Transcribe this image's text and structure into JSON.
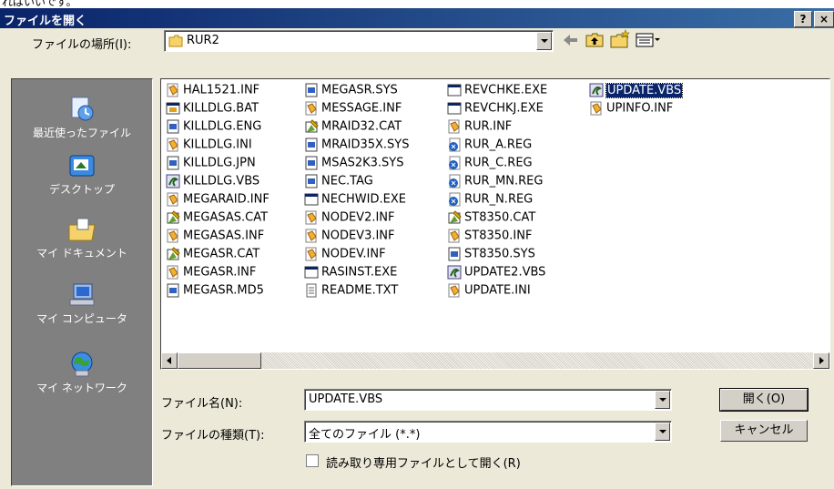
{
  "top_strip_text": "ればいいです。",
  "window": {
    "title": "ファイルを開く",
    "help_button": "?",
    "close_button": "×"
  },
  "look_in": {
    "label": "ファイルの場所(I):",
    "value": "RUR2"
  },
  "toolbar": {
    "back_icon": "back-arrow-icon",
    "up_icon": "up-folder-icon",
    "new_folder_icon": "new-folder-icon",
    "view_icon": "view-menu-icon"
  },
  "places": [
    {
      "label": "最近使ったファイル",
      "icon": "recent-files-icon"
    },
    {
      "label": "デスクトップ",
      "icon": "desktop-icon"
    },
    {
      "label": "マイ ドキュメント",
      "icon": "my-documents-icon"
    },
    {
      "label": "マイ コンピュータ",
      "icon": "my-computer-icon"
    },
    {
      "label": "マイ ネットワーク",
      "icon": "my-network-icon"
    }
  ],
  "files": [
    {
      "name": "HAL1521.INF",
      "type": "inf"
    },
    {
      "name": "KILLDLG.BAT",
      "type": "bat"
    },
    {
      "name": "KILLDLG.ENG",
      "type": "sys"
    },
    {
      "name": "KILLDLG.INI",
      "type": "inf"
    },
    {
      "name": "KILLDLG.JPN",
      "type": "sys"
    },
    {
      "name": "KILLDLG.VBS",
      "type": "vbs"
    },
    {
      "name": "MEGARAID.INF",
      "type": "inf"
    },
    {
      "name": "MEGASAS.CAT",
      "type": "cat"
    },
    {
      "name": "MEGASAS.INF",
      "type": "inf"
    },
    {
      "name": "MEGASR.CAT",
      "type": "cat"
    },
    {
      "name": "MEGASR.INF",
      "type": "inf"
    },
    {
      "name": "MEGASR.MD5",
      "type": "sys"
    },
    {
      "name": "MEGASR.SYS",
      "type": "sys"
    },
    {
      "name": "MESSAGE.INF",
      "type": "inf"
    },
    {
      "name": "MRAID32.CAT",
      "type": "cat"
    },
    {
      "name": "MRAID35X.SYS",
      "type": "sys"
    },
    {
      "name": "MSAS2K3.SYS",
      "type": "sys"
    },
    {
      "name": "NEC.TAG",
      "type": "sys"
    },
    {
      "name": "NECHWID.EXE",
      "type": "exe"
    },
    {
      "name": "NODEV2.INF",
      "type": "inf"
    },
    {
      "name": "NODEV3.INF",
      "type": "inf"
    },
    {
      "name": "NODEV.INF",
      "type": "inf"
    },
    {
      "name": "RASINST.EXE",
      "type": "exe"
    },
    {
      "name": "README.TXT",
      "type": "txt"
    },
    {
      "name": "REVCHKE.EXE",
      "type": "exe"
    },
    {
      "name": "REVCHKJ.EXE",
      "type": "exe"
    },
    {
      "name": "RUR.INF",
      "type": "inf"
    },
    {
      "name": "RUR_A.REG",
      "type": "reg"
    },
    {
      "name": "RUR_C.REG",
      "type": "reg"
    },
    {
      "name": "RUR_MN.REG",
      "type": "reg"
    },
    {
      "name": "RUR_N.REG",
      "type": "reg"
    },
    {
      "name": "ST8350.CAT",
      "type": "cat"
    },
    {
      "name": "ST8350.INF",
      "type": "inf"
    },
    {
      "name": "ST8350.SYS",
      "type": "sys"
    },
    {
      "name": "UPDATE2.VBS",
      "type": "vbs"
    },
    {
      "name": "UPDATE.INI",
      "type": "inf"
    },
    {
      "name": "UPDATE.VBS",
      "type": "vbs",
      "selected": true
    },
    {
      "name": "UPINFO.INF",
      "type": "inf"
    }
  ],
  "filename": {
    "label": "ファイル名(N):",
    "value": "UPDATE.VBS"
  },
  "filetype": {
    "label": "ファイルの種類(T):",
    "value": "全てのファイル (*.*)"
  },
  "readonly": {
    "label": "読み取り専用ファイルとして開く(R)",
    "checked": false
  },
  "buttons": {
    "open": "開く(O)",
    "cancel": "キャンセル"
  },
  "colors": {
    "titlebar": "#0a246a",
    "face": "#ece9d8",
    "places_panel": "#808080",
    "selection": "#0a246a"
  }
}
